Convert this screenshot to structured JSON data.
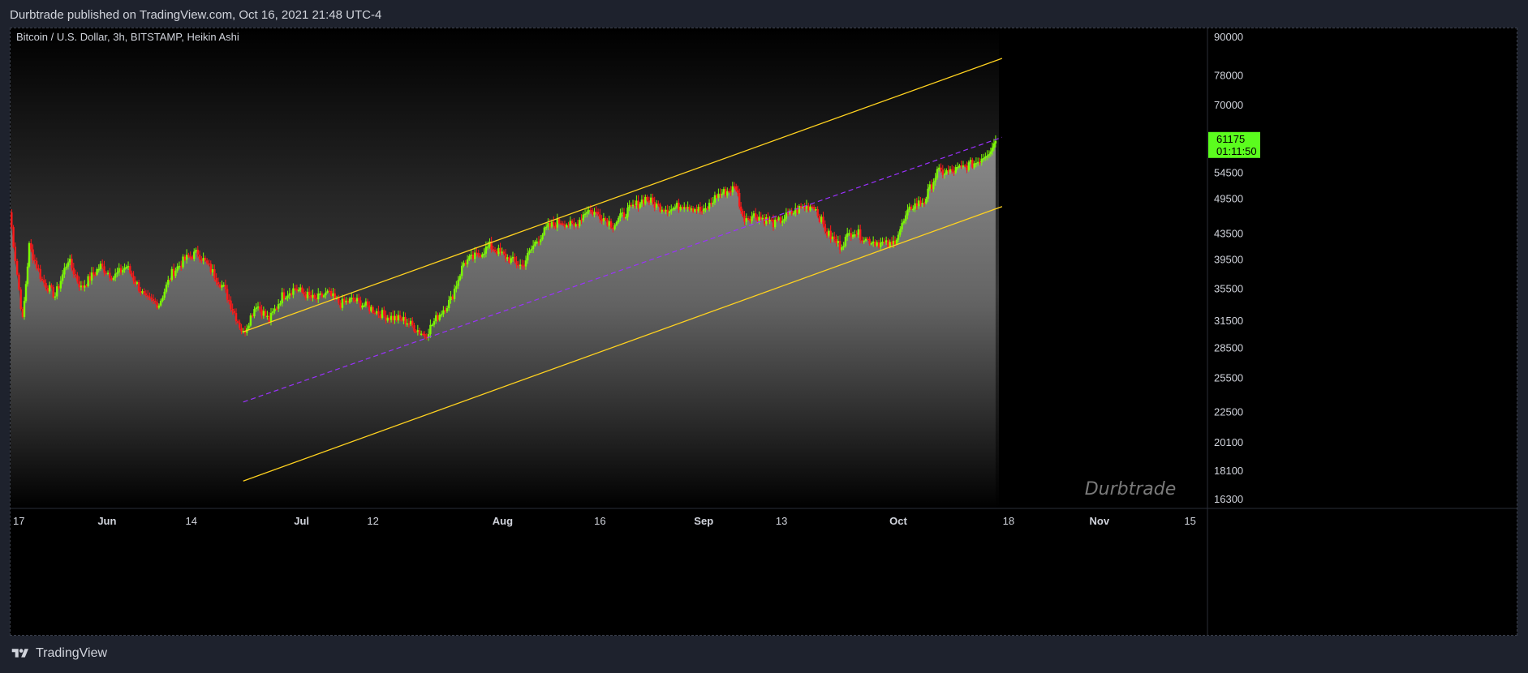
{
  "header": {
    "published_line": "Durbtrade published on TradingView.com, Oct 16, 2021 21:48 UTC-4"
  },
  "footer": {
    "brand": "TradingView"
  },
  "colors": {
    "background": "#000000",
    "frame": "#1e222d",
    "up_candle": "#7cfc00",
    "down_candle": "#ff1a1a",
    "channel_line": "#ffd21f",
    "mid_line": "#9b30ff",
    "price_badge": "#5bfd1e"
  },
  "chart_data": {
    "type": "candlestick",
    "title": "Bitcoin / U.S. Dollar, 3h, BITSTAMP, Heikin Ashi",
    "scale": "log",
    "ylim": [
      15000,
      95000
    ],
    "y_ticks": [
      "90000",
      "78000",
      "70000",
      "54500",
      "49500",
      "43500",
      "39500",
      "35500",
      "31500",
      "28500",
      "25500",
      "22500",
      "20100",
      "18100",
      "16300"
    ],
    "x_ticks": [
      "17",
      "Jun",
      "14",
      "Jul",
      "12",
      "Aug",
      "16",
      "Sep",
      "13",
      "Oct",
      "18",
      "Nov",
      "15"
    ],
    "last_price": "61175",
    "countdown": "01:11:50",
    "watermark": "Durbtrade",
    "price_path": [
      [
        "May 17",
        47000
      ],
      [
        "May 19",
        31500
      ],
      [
        "May 20",
        41500
      ],
      [
        "May 22",
        36500
      ],
      [
        "May 24",
        34500
      ],
      [
        "May 26",
        39500
      ],
      [
        "May 28",
        35500
      ],
      [
        "May 31",
        38500
      ],
      [
        "Jun 2",
        37000
      ],
      [
        "Jun 4",
        38500
      ],
      [
        "Jun 7",
        34000
      ],
      [
        "Jun 9",
        33500
      ],
      [
        "Jun 11",
        37500
      ],
      [
        "Jun 13",
        39500
      ],
      [
        "Jun 15",
        40500
      ],
      [
        "Jun 17",
        38000
      ],
      [
        "Jun 19",
        35500
      ],
      [
        "Jun 22",
        30000
      ],
      [
        "Jun 24",
        33500
      ],
      [
        "Jun 26",
        31500
      ],
      [
        "Jun 28",
        34500
      ],
      [
        "Jun 30",
        35500
      ],
      [
        "Jul 3",
        34000
      ],
      [
        "Jul 5",
        34800
      ],
      [
        "Jul 7",
        33500
      ],
      [
        "Jul 9",
        34000
      ],
      [
        "Jul 12",
        32800
      ],
      [
        "Jul 14",
        32000
      ],
      [
        "Jul 17",
        31500
      ],
      [
        "Jul 20",
        29800
      ],
      [
        "Jul 22",
        32000
      ],
      [
        "Jul 24",
        34000
      ],
      [
        "Jul 26",
        39000
      ],
      [
        "Jul 28",
        40000
      ],
      [
        "Jul 30",
        41500
      ],
      [
        "Aug 2",
        39500
      ],
      [
        "Aug 4",
        38500
      ],
      [
        "Aug 6",
        42000
      ],
      [
        "Aug 8",
        44500
      ],
      [
        "Aug 10",
        45500
      ],
      [
        "Aug 12",
        44500
      ],
      [
        "Aug 14",
        47500
      ],
      [
        "Aug 16",
        46500
      ],
      [
        "Aug 18",
        44800
      ],
      [
        "Aug 20",
        47000
      ],
      [
        "Aug 23",
        49500
      ],
      [
        "Aug 25",
        48000
      ],
      [
        "Aug 27",
        47500
      ],
      [
        "Aug 29",
        48500
      ],
      [
        "Sep 1",
        47000
      ],
      [
        "Sep 3",
        50000
      ],
      [
        "Sep 6",
        51500
      ],
      [
        "Sep 7",
        46000
      ],
      [
        "Sep 9",
        46500
      ],
      [
        "Sep 12",
        45000
      ],
      [
        "Sep 14",
        46500
      ],
      [
        "Sep 16",
        47800
      ],
      [
        "Sep 18",
        48200
      ],
      [
        "Sep 20",
        43500
      ],
      [
        "Sep 22",
        41500
      ],
      [
        "Sep 24",
        44000
      ],
      [
        "Sep 26",
        42500
      ],
      [
        "Sep 28",
        42000
      ],
      [
        "Sep 30",
        41500
      ],
      [
        "Oct 1",
        43500
      ],
      [
        "Oct 3",
        48000
      ],
      [
        "Oct 5",
        49000
      ],
      [
        "Oct 7",
        54500
      ],
      [
        "Oct 9",
        54500
      ],
      [
        "Oct 11",
        55500
      ],
      [
        "Oct 13",
        56500
      ],
      [
        "Oct 15",
        59000
      ],
      [
        "Oct 16",
        61175
      ]
    ],
    "annotations": [
      {
        "type": "upper_channel",
        "from": [
          "Jun 22",
          30200
        ],
        "to": [
          "Oct 17",
          83000
        ]
      },
      {
        "type": "mid_channel",
        "from": [
          "Jun 22",
          23300
        ],
        "to": [
          "Oct 17",
          62000
        ]
      },
      {
        "type": "lower_channel",
        "from": [
          "Jun 22",
          17400
        ],
        "to": [
          "Oct 17",
          48000
        ]
      }
    ]
  }
}
